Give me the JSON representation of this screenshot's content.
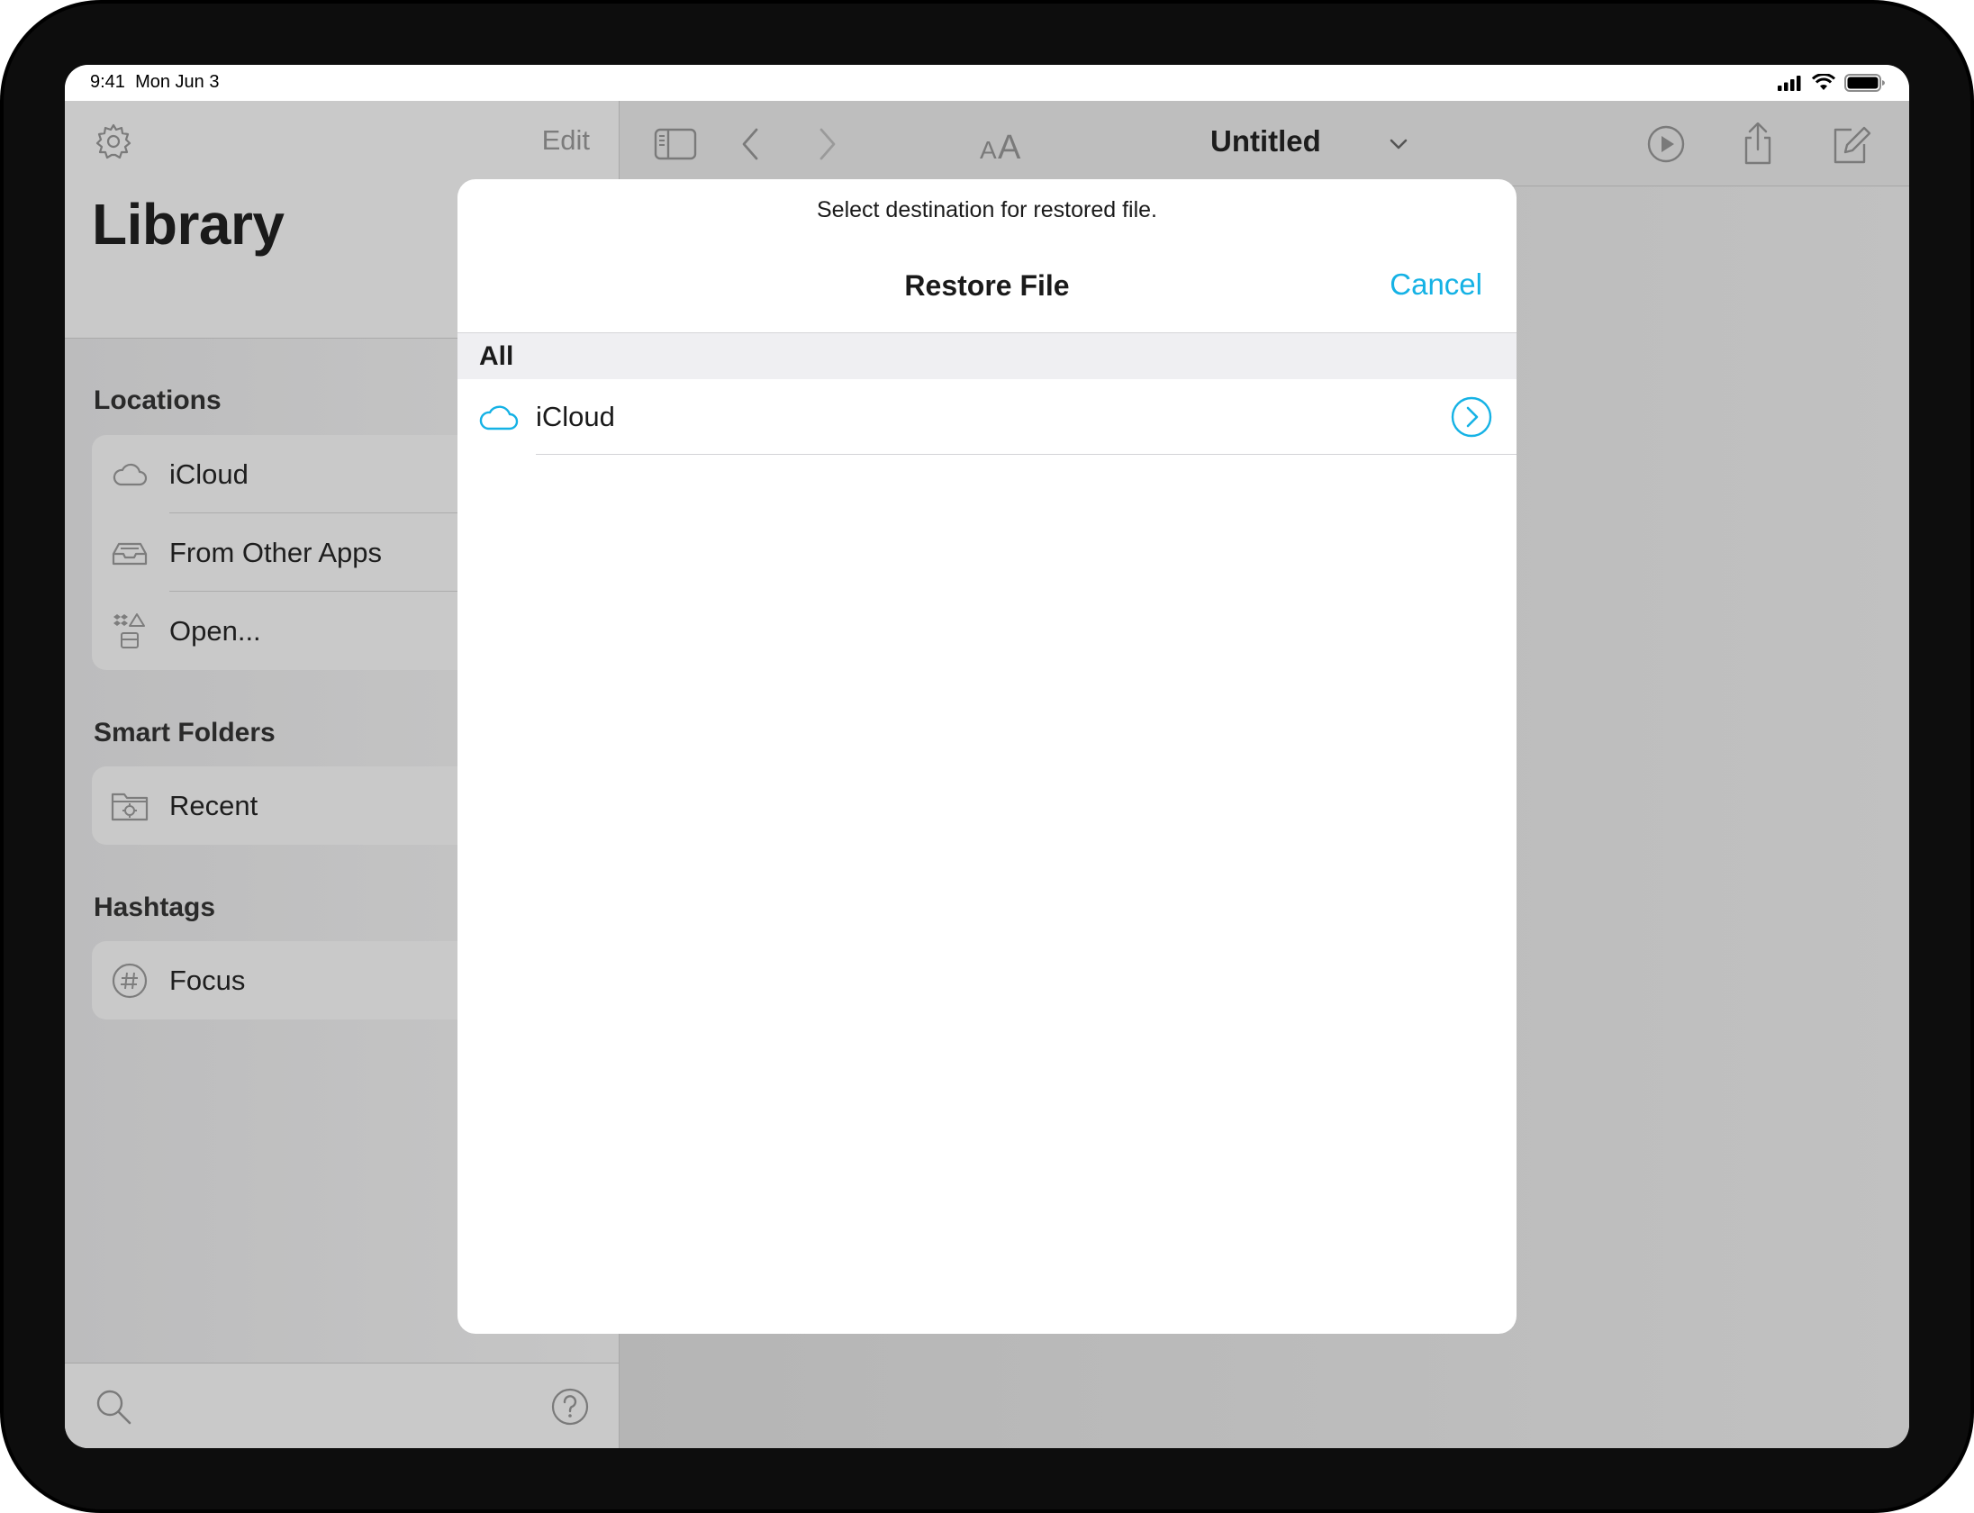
{
  "status_bar": {
    "time": "9:41",
    "date": "Mon Jun 3"
  },
  "sidebar": {
    "edit_label": "Edit",
    "title": "Library",
    "sections": {
      "locations": {
        "title": "Locations",
        "items": [
          {
            "label": "iCloud",
            "icon": "cloud-icon"
          },
          {
            "label": "From Other Apps",
            "icon": "inbox-tray-icon"
          },
          {
            "label": "Open...",
            "icon": "open-services-icon"
          }
        ]
      },
      "smart_folders": {
        "title": "Smart Folders",
        "items": [
          {
            "label": "Recent",
            "icon": "recent-folder-icon"
          }
        ]
      },
      "hashtags": {
        "title": "Hashtags",
        "items": [
          {
            "label": "Focus",
            "icon": "hashtag-icon"
          }
        ]
      }
    }
  },
  "editor": {
    "document_title": "Untitled"
  },
  "modal": {
    "prompt": "Select destination for restored file.",
    "title": "Restore File",
    "cancel_label": "Cancel",
    "section_header": "All",
    "destinations": [
      {
        "label": "iCloud",
        "icon": "cloud-icon"
      }
    ]
  },
  "colors": {
    "accent": "#15b2e5",
    "sidebar_bg": "#c4c4c4",
    "modal_bg": "#ffffff",
    "section_bg": "#efeff2"
  }
}
